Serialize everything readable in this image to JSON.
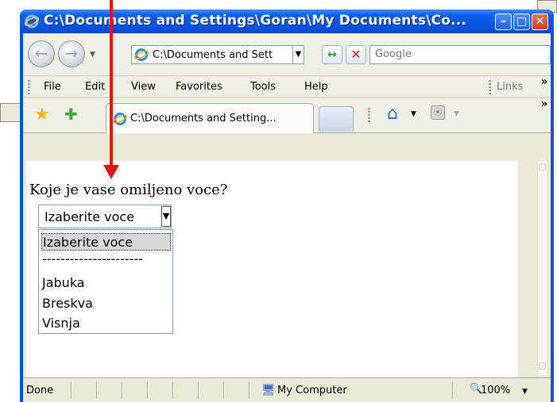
{
  "window": {
    "title": "C:\\Documents and Settings\\Goran\\My Documents\\Co...",
    "caption_min": "–",
    "caption_max": "□",
    "caption_close": "✕"
  },
  "navbar": {
    "address": "C:\\Documents and Sett",
    "search_placeholder": "Google"
  },
  "menu": {
    "items": [
      "File",
      "Edit",
      "View",
      "Favorites",
      "Tools",
      "Help"
    ],
    "links_label": "Links",
    "more": "»"
  },
  "tabs": {
    "active_tab_label": "C:\\Documents and Setting...",
    "more": "»"
  },
  "page": {
    "question": "Koje je vase omiljeno voce?",
    "select": {
      "value": "Izaberite voce",
      "options": [
        "Izaberite voce",
        "----------------------",
        "",
        "Jabuka",
        "Breskva",
        "Visnja"
      ],
      "highlighted_index": 0
    }
  },
  "statusbar": {
    "status": "Done",
    "zone": "My Computer",
    "zoom": "100%"
  },
  "colors": {
    "annotation_arrow": "#e51414",
    "titlebar": "#0a5ce6"
  }
}
